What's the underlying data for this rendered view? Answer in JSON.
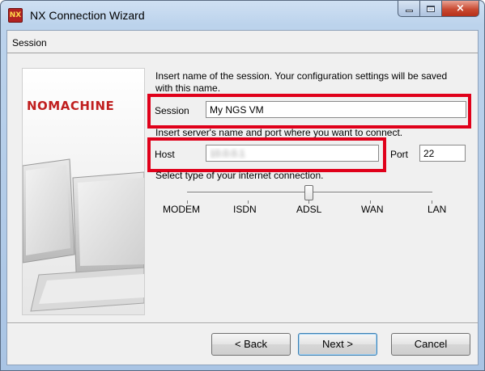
{
  "window": {
    "title": "NX Connection Wizard",
    "icon": "nx-app-icon",
    "app_icon_text": "NX",
    "controls": {
      "minimize": "minimize-icon",
      "maximize": "maximize-icon",
      "close": "×"
    }
  },
  "header": {
    "label": "Session"
  },
  "side_panel": {
    "brand": "NOMACHINE",
    "image": "monitors-illustration"
  },
  "form": {
    "intro_line1": "Insert name of the session. Your configuration settings will be saved",
    "intro_line2": "with this name.",
    "session_label": "Session",
    "session_value": "My NGS VM",
    "server_prompt": "Insert server's name and port where you want to connect.",
    "host_label": "Host",
    "host_value": "10.0.0.1",
    "port_label": "Port",
    "port_value": "22",
    "connection_prompt": "Select type of your internet connection."
  },
  "connection": {
    "options": [
      "MODEM",
      "ISDN",
      "ADSL",
      "WAN",
      "LAN"
    ],
    "selected": "ADSL",
    "selected_index": 2
  },
  "buttons": {
    "back": "< Back",
    "next": "Next >",
    "cancel": "Cancel"
  },
  "colors": {
    "highlight": "#e0001a",
    "brand": "#c01f1f"
  }
}
